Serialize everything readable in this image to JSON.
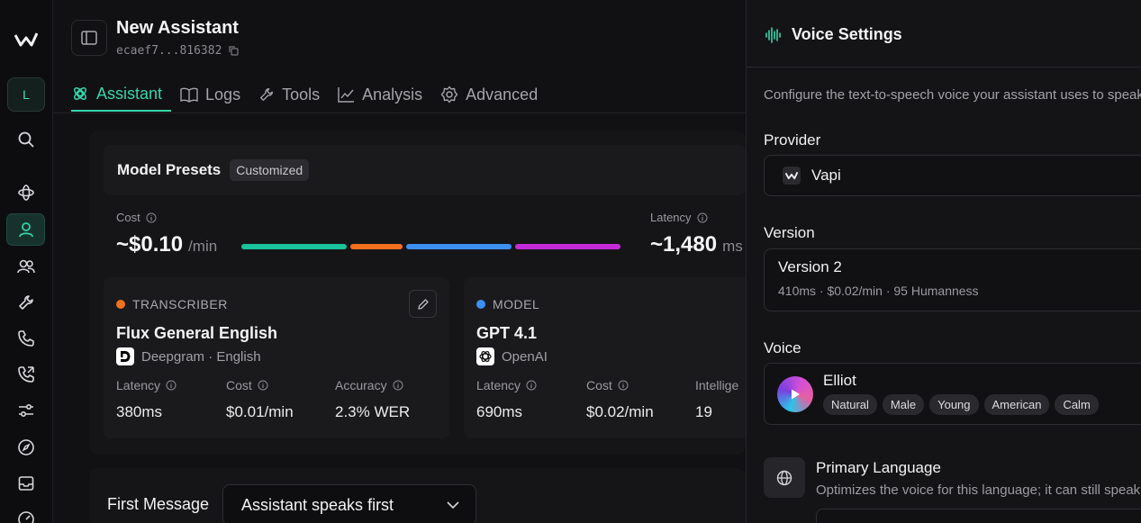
{
  "rail": {
    "avatar_letter": "L",
    "items": [
      "logo-icon",
      "search-icon",
      "orbit-icon",
      "user-icon",
      "users-icon",
      "wrench-icon",
      "phone-icon",
      "phone-forward-icon",
      "sliders-icon",
      "compass-icon",
      "inbox-icon",
      "gauge-icon"
    ]
  },
  "header": {
    "title": "New Assistant",
    "id": "ecaef7...816382"
  },
  "tabs": [
    {
      "label": "Assistant",
      "icon": "brain-icon",
      "active": true
    },
    {
      "label": "Logs",
      "icon": "book-icon"
    },
    {
      "label": "Tools",
      "icon": "wrench-icon"
    },
    {
      "label": "Analysis",
      "icon": "chart-icon"
    },
    {
      "label": "Advanced",
      "icon": "gear-icon"
    }
  ],
  "presets": {
    "title": "Model Presets",
    "badge": "Customized"
  },
  "cost": {
    "label": "Cost",
    "value": "~$0.10",
    "unit": "/min",
    "segments": [
      {
        "color": "#19c39b",
        "share": 0.2
      },
      {
        "color": "#f2701e",
        "share": 0.1
      },
      {
        "color": "#3b8ff0",
        "share": 0.2
      },
      {
        "color": "#c42bd8",
        "share": 0.2
      }
    ]
  },
  "latency": {
    "label": "Latency",
    "value": "~1,480",
    "unit": "ms"
  },
  "transcriber": {
    "kind": "TRANSCRIBER",
    "dot_color": "#f2701e",
    "name": "Flux General English",
    "provider": "Deepgram · English",
    "stats": [
      {
        "label": "Latency",
        "value": "380ms"
      },
      {
        "label": "Cost",
        "value": "$0.01/min"
      },
      {
        "label": "Accuracy",
        "value": "2.3% WER"
      }
    ]
  },
  "model": {
    "kind": "MODEL",
    "dot_color": "#3b8ff0",
    "name": "GPT 4.1",
    "provider": "OpenAI",
    "stats": [
      {
        "label": "Latency",
        "value": "690ms"
      },
      {
        "label": "Cost",
        "value": "$0.02/min"
      },
      {
        "label": "Intellige",
        "value": "19"
      }
    ]
  },
  "first_message": {
    "label": "First Message",
    "value": "Assistant speaks first"
  },
  "panel": {
    "title": "Voice Settings",
    "description": "Configure the text-to-speech voice your assistant uses to speak",
    "provider_label": "Provider",
    "provider_value": "Vapi",
    "version_label": "Version",
    "version_value": "Version 2",
    "version_meta": "410ms · $0.02/min · 95 Humanness",
    "voice_label": "Voice",
    "voice_name": "Elliot",
    "voice_tags": [
      "Natural",
      "Male",
      "Young",
      "American",
      "Calm"
    ],
    "lang_title": "Primary Language",
    "lang_desc": "Optimizes the voice for this language; it can still speak"
  }
}
